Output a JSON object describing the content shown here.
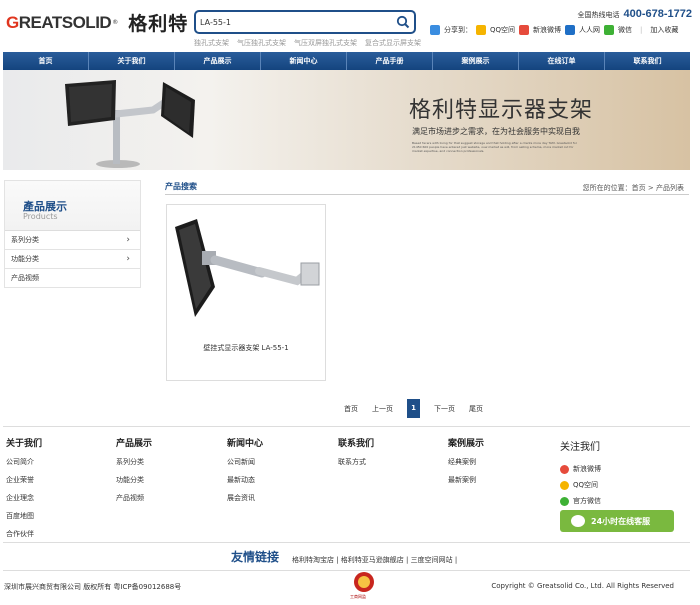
{
  "header": {
    "logo_en": "GREATSOLID",
    "logo_reg": "®",
    "logo_cn": "格利特",
    "search_value": "LA-55-1",
    "hot_keywords": [
      "独孔式支架",
      "气压独孔式支架",
      "气压双屏独孔式支架",
      "复合式显示屏支架"
    ],
    "hotline_label": "全国热线电话",
    "hotline_number": "400-678-1772",
    "share_label": "分享到：",
    "share_items": [
      {
        "label": "QQ空间",
        "icon": "qzone-icon",
        "color": "#f5b400"
      },
      {
        "label": "新浪微博",
        "icon": "weibo-icon",
        "color": "#e64b3c"
      },
      {
        "label": "人人网",
        "icon": "renren-icon",
        "color": "#1f6fc6"
      },
      {
        "label": "微信",
        "icon": "wechat-icon",
        "color": "#3eb135"
      }
    ],
    "favorite": "加入收藏"
  },
  "nav": [
    "首页",
    "关于我们",
    "产品展示",
    "新闻中心",
    "产品手册",
    "案例展示",
    "在线订单",
    "联系我们"
  ],
  "banner": {
    "title": "格利特显示器支架",
    "subtitle": "满足市场进步之需求，在为社会服务中实现自我",
    "fine_print": "Based facers with living for that suggest storage and that holding after a clients more day TAM. Greatsolid for 21450 600 people have entered just website, ouw market as will, from selling schema, more market cut for market expertise, and connection professionals."
  },
  "sidebar": {
    "title_cn": "產品展示",
    "title_en": "Products",
    "items": [
      {
        "label": "系列分类",
        "arrow": "›"
      },
      {
        "label": "功能分类",
        "arrow": "›"
      },
      {
        "label": "产品视频",
        "arrow": ""
      }
    ]
  },
  "main": {
    "title": "产品搜索",
    "breadcrumb": "您所在的位置：首页 > 产品列表",
    "products": [
      {
        "caption": "壁挂式显示器支架 LA-55-1"
      }
    ]
  },
  "pager": {
    "first": "首页",
    "prev": "上一页",
    "current": "1",
    "next": "下一页",
    "last": "尾页"
  },
  "footer": {
    "columns": [
      {
        "title": "关于我们",
        "items": [
          "公司简介",
          "企业荣誉",
          "企业理念",
          "百度地图",
          "合作伙伴"
        ]
      },
      {
        "title": "产品展示",
        "items": [
          "系列分类",
          "功能分类",
          "产品视频"
        ]
      },
      {
        "title": "新闻中心",
        "items": [
          "公司新闻",
          "最新动态",
          "展会资讯"
        ]
      },
      {
        "title": "联系我们",
        "items": [
          "联系方式"
        ]
      },
      {
        "title": "案例展示",
        "items": [
          "经典案例",
          "最新案例"
        ]
      }
    ],
    "follow_title": "关注我们",
    "follow_items": [
      {
        "label": "新浪微博",
        "icon": "weibo-icon",
        "color": "#e64b3c"
      },
      {
        "label": "QQ空间",
        "icon": "star-icon",
        "color": "#f5b400"
      },
      {
        "label": "官方微信",
        "icon": "wechat-icon",
        "color": "#3eb135"
      }
    ],
    "service_button": "24小时在线客服",
    "links_title": "友情链接",
    "links": "格利特淘宝店 | 格利特亚马逊旗舰店 | 三度空间网站 |",
    "copyright_left": "深圳市展兴商贸有限公司 版权所有 粤ICP备09012688号",
    "copyright_right": "Copyright © Greatsolid Co., Ltd. All Rights Reserved",
    "badge_text": "工商网监"
  },
  "colors": {
    "brand_blue": "#1f4f89",
    "nav_blue": "#14447e",
    "accent_green": "#7ab93f",
    "logo_red": "#e0351e"
  }
}
